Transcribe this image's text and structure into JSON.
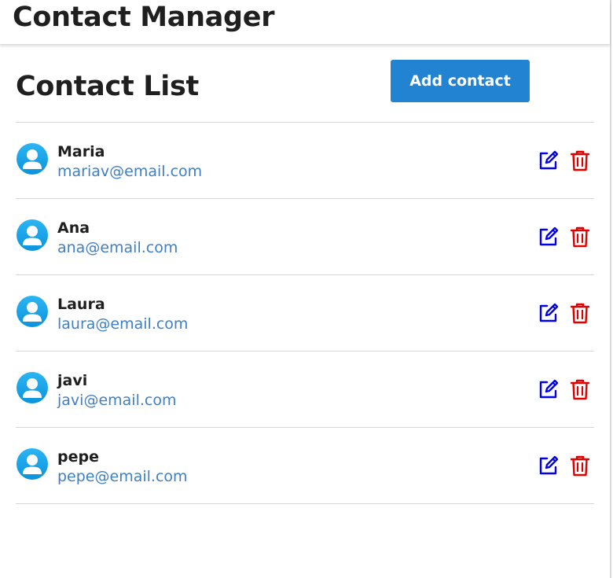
{
  "app": {
    "title": "Contact Manager"
  },
  "list": {
    "title": "Contact List",
    "add_button_label": "Add contact"
  },
  "contacts": [
    {
      "name": "Maria",
      "email": "mariav@email.com"
    },
    {
      "name": "Ana",
      "email": "ana@email.com"
    },
    {
      "name": "Laura",
      "email": "laura@email.com"
    },
    {
      "name": "javi",
      "email": "javi@email.com"
    },
    {
      "name": "pepe",
      "email": "pepe@email.com"
    }
  ],
  "icons": {
    "avatar": "user-avatar-icon",
    "edit": "edit-icon",
    "delete": "trash-icon"
  },
  "colors": {
    "accent": "#2283d3",
    "email": "#3f7fc5",
    "edit": "#0000ee",
    "delete": "#e00000",
    "avatar": "#0b93dd"
  }
}
